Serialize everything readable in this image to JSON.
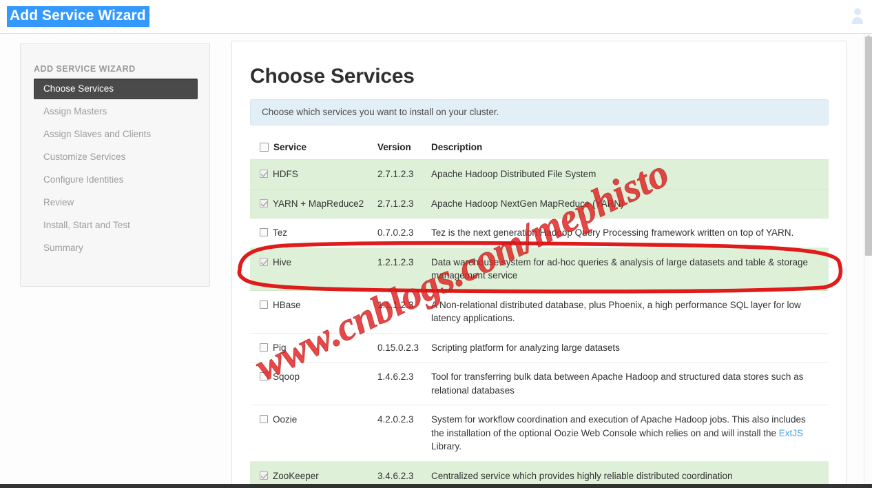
{
  "window": {
    "title": "Add Service Wizard",
    "title_selected": true,
    "top_right_icon": "user-icon"
  },
  "sidebar": {
    "heading": "ADD SERVICE WIZARD",
    "items": [
      {
        "label": "Choose Services",
        "active": true
      },
      {
        "label": "Assign Masters",
        "active": false
      },
      {
        "label": "Assign Slaves and Clients",
        "active": false
      },
      {
        "label": "Customize Services",
        "active": false
      },
      {
        "label": "Configure Identities",
        "active": false
      },
      {
        "label": "Review",
        "active": false
      },
      {
        "label": "Install, Start and Test",
        "active": false
      },
      {
        "label": "Summary",
        "active": false
      }
    ]
  },
  "main": {
    "page_title": "Choose Services",
    "info_banner": "Choose which services you want to install on your cluster.",
    "table": {
      "headers": {
        "select_all": false,
        "service": "Service",
        "version": "Version",
        "description": "Description"
      },
      "rows": [
        {
          "checked": true,
          "service": "HDFS",
          "version": "2.7.1.2.3",
          "description": "Apache Hadoop Distributed File System",
          "highlighted": true
        },
        {
          "checked": true,
          "service": "YARN + MapReduce2",
          "version": "2.7.1.2.3",
          "description": "Apache Hadoop NextGen MapReduce (YARN)",
          "highlighted": true
        },
        {
          "checked": false,
          "service": "Tez",
          "version": "0.7.0.2.3",
          "description": "Tez is the next generation Hadoop Query Processing framework written on top of YARN.",
          "highlighted": false
        },
        {
          "checked": true,
          "service": "Hive",
          "version": "1.2.1.2.3",
          "description": "Data warehouse system for ad-hoc queries & analysis of large datasets and table & storage management service",
          "highlighted": true
        },
        {
          "checked": false,
          "service": "HBase",
          "version": "1.1.1.2.3",
          "description": "A Non-relational distributed database, plus Phoenix, a high performance SQL layer for low latency applications.",
          "highlighted": false
        },
        {
          "checked": false,
          "service": "Pig",
          "version": "0.15.0.2.3",
          "description": "Scripting platform for analyzing large datasets",
          "highlighted": false
        },
        {
          "checked": false,
          "service": "Sqoop",
          "version": "1.4.6.2.3",
          "description": "Tool for transferring bulk data between Apache Hadoop and structured data stores such as relational databases",
          "highlighted": false
        },
        {
          "checked": false,
          "service": "Oozie",
          "version": "4.2.0.2.3",
          "description_before_link": "System for workflow coordination and execution of Apache Hadoop jobs. This also includes the installation of the optional Oozie Web Console which relies on and will install the ",
          "link_label": "ExtJS",
          "description_after_link": " Library.",
          "highlighted": false
        },
        {
          "checked": true,
          "service": "ZooKeeper",
          "version": "3.4.6.2.3",
          "description": "Centralized service which provides highly reliable distributed coordination",
          "highlighted": true
        }
      ]
    }
  },
  "annotations": {
    "watermark_text": "www.cnblogs.com/mephisto",
    "watermark_color": "#e02020",
    "highlight_ellipse_target": "Hive",
    "highlight_ellipse_color": "#e01b1b"
  },
  "colors": {
    "title_highlight": "#3399ff",
    "selected_row": "#dff0d8",
    "info_banner": "#e3eff6",
    "active_nav": "#4a4a4a",
    "link": "#4aa3df"
  },
  "scrollbar": {
    "orientation": "vertical",
    "thumb_position": "top"
  }
}
